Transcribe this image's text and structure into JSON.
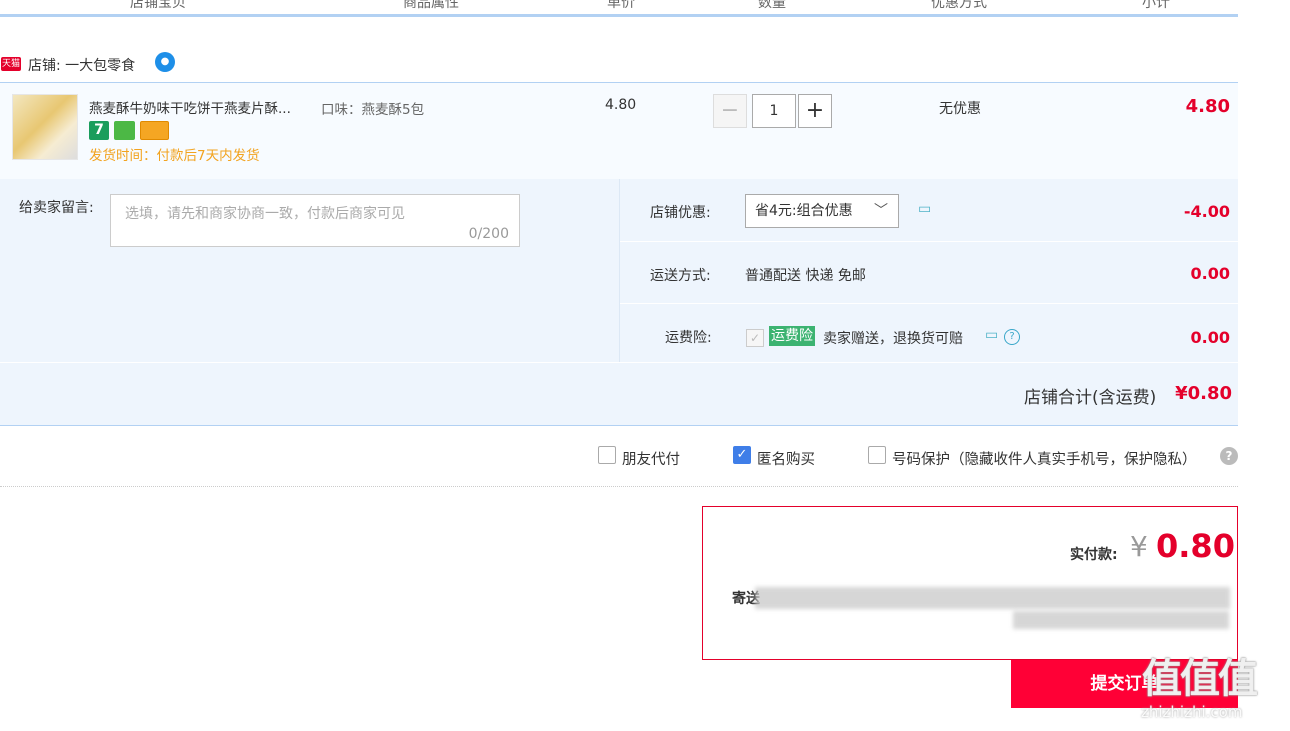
{
  "table_header": [
    "店铺宝贝",
    "商品属性",
    "单价",
    "数量",
    "优惠方式",
    "小计"
  ],
  "shop": {
    "badge": "天猫",
    "label": "店铺: 一大包零食"
  },
  "item": {
    "title": "燕麦酥牛奶味干吃饼干燕麦片酥...",
    "attribute": "口味：燕麦酥5包",
    "ship_time": "发货时间：付款后7天内发货",
    "badge_number": "7",
    "price": "4.80",
    "quantity": "1",
    "qty_minus": "−",
    "qty_plus": "+",
    "discount": "无优惠",
    "subtotal": "4.80"
  },
  "message": {
    "label": "给卖家留言:",
    "placeholder": "选填，请先和商家协商一致，付款后商家可见",
    "count": "0/200"
  },
  "options": {
    "shop_discount_label": "店铺优惠:",
    "shop_discount_value": "省4元:组合优惠",
    "shop_discount_amount": "-4.00",
    "shipping_label": "运送方式:",
    "shipping_value": "普通配送 快递 免邮",
    "shipping_amount": "0.00",
    "insurance_label": "运费险:",
    "insurance_badge": "运费险",
    "insurance_desc": "卖家赠送，退换货可赔",
    "insurance_amount": "0.00",
    "shop_total_label": "店铺合计(含运费)",
    "shop_total_value": "¥0.80"
  },
  "checkboxes": {
    "friend_pay": "朋友代付",
    "anonymous": "匿名购买",
    "number_protect": "号码保护（隐藏收件人真实手机号，保护隐私）"
  },
  "payment": {
    "label": "实付款:",
    "currency": "¥",
    "value": "0.80",
    "address_label": "寄送"
  },
  "submit_label": "提交订单",
  "watermark": {
    "brand": "值值值",
    "site": "zhizhizhi.com"
  }
}
